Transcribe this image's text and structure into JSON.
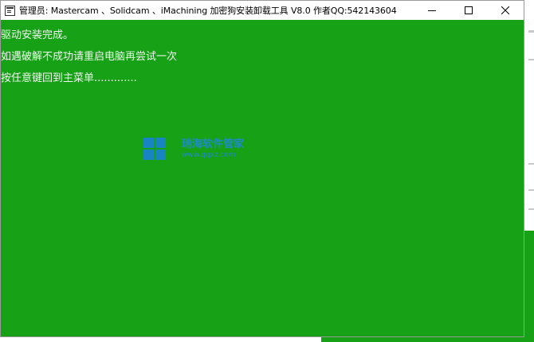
{
  "window": {
    "title": "管理员:  Mastercam 、Solidcam 、iMachining 加密狗安装卸载工具 V8.0  作者QQ:542143604"
  },
  "console": {
    "lines": [
      "驱动安装完成。",
      "如遇破解不成功请重启电脑再尝试一次",
      "按任意键回到主菜单............."
    ]
  },
  "watermark": {
    "name": "瑞海软件管家",
    "url": "www.qqxz.com"
  },
  "colors": {
    "console_bg": "#17a116",
    "console_text": "#f2f7f2",
    "watermark": "#1f86e6"
  },
  "icons": {
    "app": "console-window-icon",
    "minimize": "minimize-icon",
    "maximize": "maximize-icon",
    "close": "close-icon",
    "watermark_logo": "windows-logo-icon"
  }
}
